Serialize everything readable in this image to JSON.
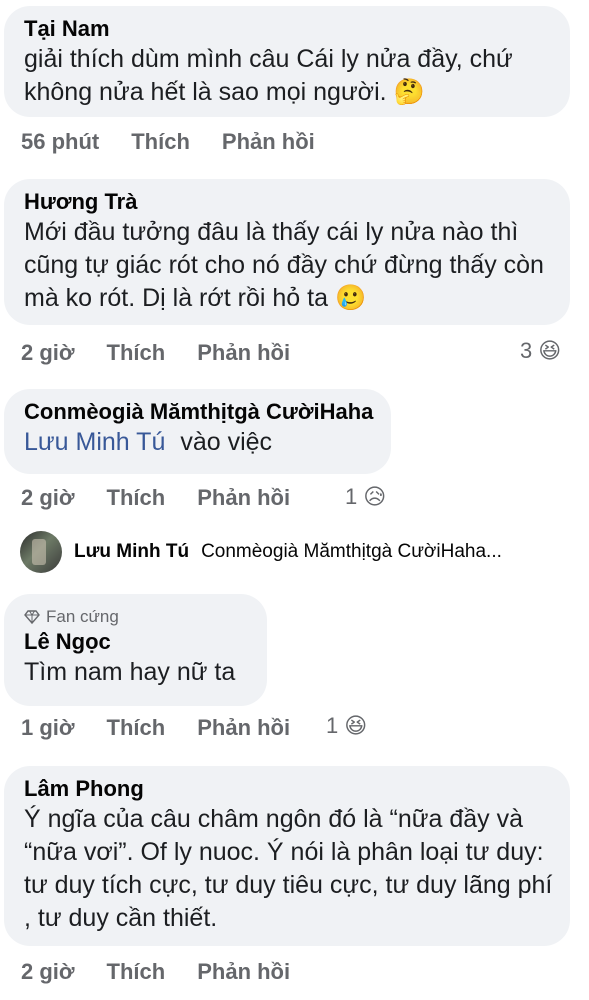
{
  "comments": [
    {
      "author": "Tại Nam",
      "text": "giải thích dùm mình câu Cái ly nửa đầy, chứ không nửa hết là sao mọi người.",
      "emoji": "🤔",
      "time": "56 phút",
      "like": "Thích",
      "reply": "Phản hồi"
    },
    {
      "author": "Hương Trà",
      "text": "Mới đầu tưởng đâu là thấy cái ly nửa nào thì cũng tự giác rót cho nó đầy chứ đừng thấy còn mà ko rót. Dị là rớt rồi hỏ ta",
      "emoji": "🥲",
      "time": "2 giờ",
      "like": "Thích",
      "reply": "Phản hồi",
      "reaction_count": "3",
      "reaction_emoji": "😆"
    },
    {
      "author": "Conmèogià Mămthịtgà CườiHaha",
      "mention": "Lưu Minh Tú",
      "text": "vào việc",
      "time": "2 giờ",
      "like": "Thích",
      "reply": "Phản hồi",
      "reaction_count": "1",
      "reaction_emoji": "😥"
    },
    {
      "badge": "Fan cứng",
      "author": "Lê Ngọc",
      "text": "Tìm nam hay nữ ta",
      "time": "1 giờ",
      "like": "Thích",
      "reply": "Phản hồi",
      "reaction_count": "1",
      "reaction_emoji": "😆"
    },
    {
      "author": "Lâm Phong",
      "text": "Ý ngĩa của câu châm ngôn đó là “nữa đầy và “nữa vơi”. Of ly nuoc. Ý nói là phân loại tư duy: tư duy tích cực, tư duy tiêu cực, tư duy lãng phí , tư duy cần thiết.",
      "time": "2 giờ",
      "like": "Thích",
      "reply": "Phản hồi"
    }
  ],
  "reply_preview": {
    "name": "Lưu Minh Tú",
    "text": "Conmèogià Mămthịtgà CườiHaha..."
  }
}
